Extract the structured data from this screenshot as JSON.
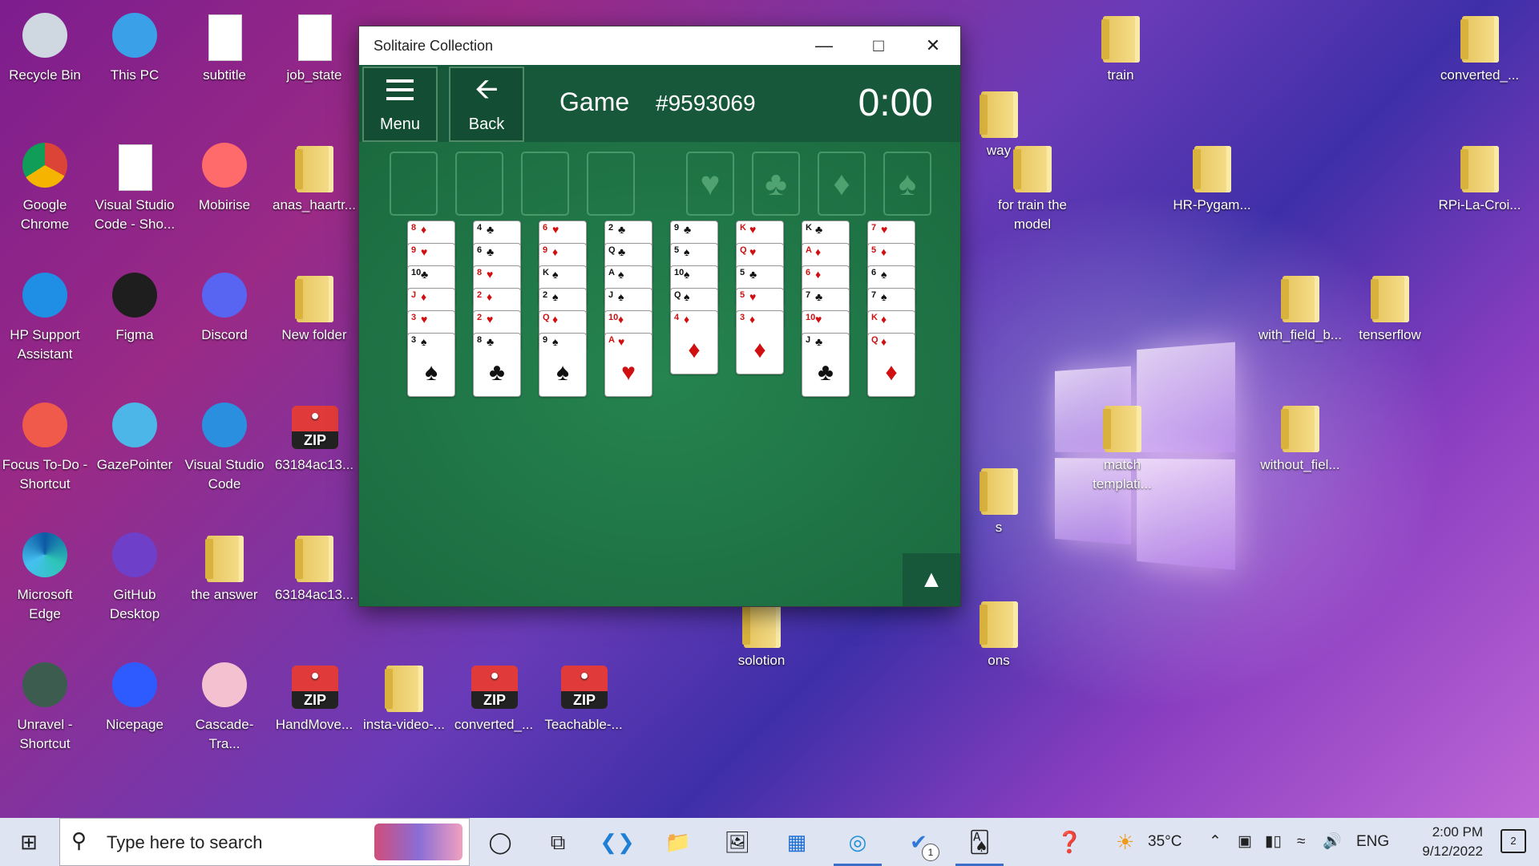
{
  "desktop": {
    "icons": [
      {
        "label": "Recycle Bin",
        "icon": "recycle-bin-icon"
      },
      {
        "label": "This PC",
        "icon": "computer-icon"
      },
      {
        "label": "subtitle",
        "icon": "python-file-icon"
      },
      {
        "label": "job_state",
        "icon": "file-icon"
      },
      {
        "label": "Google Chrome",
        "icon": "chrome-icon"
      },
      {
        "label": "Visual Studio Code - Sho...",
        "icon": "file-icon"
      },
      {
        "label": "Mobirise",
        "icon": "mobirise-icon"
      },
      {
        "label": "anas_haartr...",
        "icon": "folder-icon"
      },
      {
        "label": "HP Support Assistant",
        "icon": "help-icon"
      },
      {
        "label": "Figma",
        "icon": "figma-icon"
      },
      {
        "label": "Discord",
        "icon": "discord-icon"
      },
      {
        "label": "New folder",
        "icon": "folder-icon"
      },
      {
        "label": "Focus To-Do - Shortcut",
        "icon": "focus-todo-icon"
      },
      {
        "label": "GazePointer",
        "icon": "gazepointer-icon"
      },
      {
        "label": "Visual Studio Code",
        "icon": "vscode-icon"
      },
      {
        "label": "63184ac13...",
        "icon": "zip-icon"
      },
      {
        "label": "Microsoft Edge",
        "icon": "edge-icon"
      },
      {
        "label": "GitHub Desktop",
        "icon": "github-icon"
      },
      {
        "label": "the answer",
        "icon": "folder-icon"
      },
      {
        "label": "63184ac13...",
        "icon": "folder-icon"
      },
      {
        "label": "Unravel - Shortcut",
        "icon": "game-icon"
      },
      {
        "label": "Nicepage",
        "icon": "nicepage-icon"
      },
      {
        "label": "Cascade-Tra...",
        "icon": "flask-icon"
      },
      {
        "label": "HandMove...",
        "icon": "zip-icon"
      },
      {
        "label": "insta-video-...",
        "icon": "folder-icon"
      },
      {
        "label": "converted_...",
        "icon": "zip-icon"
      },
      {
        "label": "Teachable-...",
        "icon": "zip-icon"
      },
      {
        "label": "train",
        "icon": "folder-icon"
      },
      {
        "label": "converted_...",
        "icon": "folder-icon"
      },
      {
        "label": "for train the model",
        "icon": "folder-icon"
      },
      {
        "label": "HR-Pygam...",
        "icon": "video-icon"
      },
      {
        "label": "RPi-La-Croi...",
        "icon": "folder-icon"
      },
      {
        "label": "with_field_b...",
        "icon": "folder-icon"
      },
      {
        "label": "tenserflow",
        "icon": "folder-icon"
      },
      {
        "label": "match templati...",
        "icon": "folder-icon"
      },
      {
        "label": "without_fiel...",
        "icon": "folder-icon"
      },
      {
        "label": "solotion",
        "icon": "folder-icon"
      },
      {
        "label": "way",
        "icon": "folder-icon"
      },
      {
        "label": "ons",
        "icon": "folder-icon"
      },
      {
        "label": "s",
        "icon": "folder-icon"
      }
    ]
  },
  "window": {
    "title": "Solitaire Collection",
    "menu_label": "Menu",
    "back_label": "Back",
    "game_label": "Game",
    "game_number": "#9593069",
    "timer": "0:00",
    "foundations": [
      "♥",
      "♣",
      "♦",
      "♠"
    ],
    "columns": [
      {
        "cards": [
          {
            "r": "8",
            "s": "♦",
            "c": "red"
          },
          {
            "r": "9",
            "s": "♥",
            "c": "red"
          },
          {
            "r": "10",
            "s": "♣",
            "c": "blk"
          },
          {
            "r": "J",
            "s": "♦",
            "c": "red"
          },
          {
            "r": "3",
            "s": "♥",
            "c": "red"
          },
          {
            "r": "3",
            "s": "♠",
            "c": "blk"
          }
        ]
      },
      {
        "cards": [
          {
            "r": "4",
            "s": "♣",
            "c": "blk"
          },
          {
            "r": "6",
            "s": "♣",
            "c": "blk"
          },
          {
            "r": "8",
            "s": "♥",
            "c": "red"
          },
          {
            "r": "2",
            "s": "♦",
            "c": "red"
          },
          {
            "r": "2",
            "s": "♥",
            "c": "red"
          },
          {
            "r": "8",
            "s": "♣",
            "c": "blk"
          }
        ]
      },
      {
        "cards": [
          {
            "r": "6",
            "s": "♥",
            "c": "red"
          },
          {
            "r": "9",
            "s": "♦",
            "c": "red"
          },
          {
            "r": "K",
            "s": "♠",
            "c": "blk"
          },
          {
            "r": "2",
            "s": "♠",
            "c": "blk"
          },
          {
            "r": "Q",
            "s": "♦",
            "c": "red"
          },
          {
            "r": "9",
            "s": "♠",
            "c": "blk"
          }
        ]
      },
      {
        "cards": [
          {
            "r": "2",
            "s": "♣",
            "c": "blk"
          },
          {
            "r": "Q",
            "s": "♣",
            "c": "blk"
          },
          {
            "r": "A",
            "s": "♠",
            "c": "blk"
          },
          {
            "r": "J",
            "s": "♠",
            "c": "blk"
          },
          {
            "r": "10",
            "s": "♦",
            "c": "red"
          },
          {
            "r": "A",
            "s": "♥",
            "c": "red"
          }
        ]
      },
      {
        "cards": [
          {
            "r": "9",
            "s": "♣",
            "c": "blk"
          },
          {
            "r": "5",
            "s": "♠",
            "c": "blk"
          },
          {
            "r": "10",
            "s": "♠",
            "c": "blk"
          },
          {
            "r": "Q",
            "s": "♠",
            "c": "blk"
          },
          {
            "r": "4",
            "s": "♦",
            "c": "red"
          }
        ]
      },
      {
        "cards": [
          {
            "r": "K",
            "s": "♥",
            "c": "red"
          },
          {
            "r": "Q",
            "s": "♥",
            "c": "red"
          },
          {
            "r": "5",
            "s": "♣",
            "c": "blk"
          },
          {
            "r": "5",
            "s": "♥",
            "c": "red"
          },
          {
            "r": "3",
            "s": "♦",
            "c": "red"
          }
        ]
      },
      {
        "cards": [
          {
            "r": "K",
            "s": "♣",
            "c": "blk"
          },
          {
            "r": "A",
            "s": "♦",
            "c": "red"
          },
          {
            "r": "6",
            "s": "♦",
            "c": "red"
          },
          {
            "r": "7",
            "s": "♣",
            "c": "blk"
          },
          {
            "r": "10",
            "s": "♥",
            "c": "red"
          },
          {
            "r": "J",
            "s": "♣",
            "c": "blk"
          }
        ]
      },
      {
        "cards": [
          {
            "r": "7",
            "s": "♥",
            "c": "red"
          },
          {
            "r": "5",
            "s": "♦",
            "c": "red"
          },
          {
            "r": "6",
            "s": "♠",
            "c": "blk"
          },
          {
            "r": "7",
            "s": "♠",
            "c": "blk"
          },
          {
            "r": "K",
            "s": "♦",
            "c": "red"
          },
          {
            "r": "Q",
            "s": "♦",
            "c": "red"
          }
        ]
      }
    ]
  },
  "taskbar": {
    "search_placeholder": "Type here to search",
    "temperature": "35°C",
    "language": "ENG",
    "time": "2:00 PM",
    "date": "9/12/2022",
    "notification_count": "2",
    "todo_badge": "1"
  }
}
